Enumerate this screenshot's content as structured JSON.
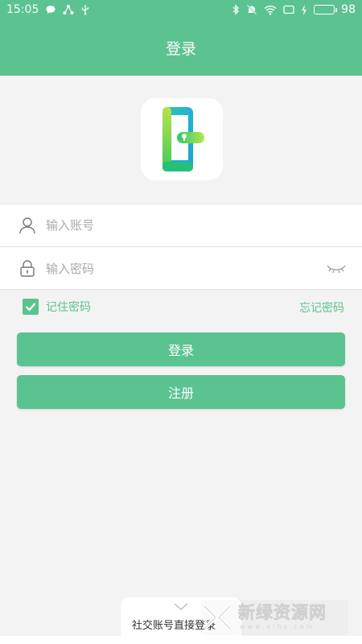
{
  "status_bar": {
    "time": "15:05",
    "battery": "98",
    "icons_left": [
      "message-icon",
      "share-icon",
      "usb-icon"
    ],
    "icons_right": [
      "bluetooth-icon",
      "mute-icon",
      "wifi-icon",
      "screen-icon",
      "charging-icon",
      "battery-icon"
    ]
  },
  "header": {
    "title": "登录"
  },
  "form": {
    "account_placeholder": "输入账号",
    "account_value": "",
    "password_placeholder": "输入密码",
    "password_value": ""
  },
  "options": {
    "remember_label": "记住密码",
    "remember_checked": true,
    "forgot_label": "忘记密码"
  },
  "buttons": {
    "login": "登录",
    "register": "注册"
  },
  "social": {
    "label": "社交账号直接登录"
  },
  "watermark": {
    "cn": "新绿资源网",
    "en": "www.xlhs.com"
  },
  "colors": {
    "accent": "#5bc38f",
    "background": "#f3f3f3"
  }
}
